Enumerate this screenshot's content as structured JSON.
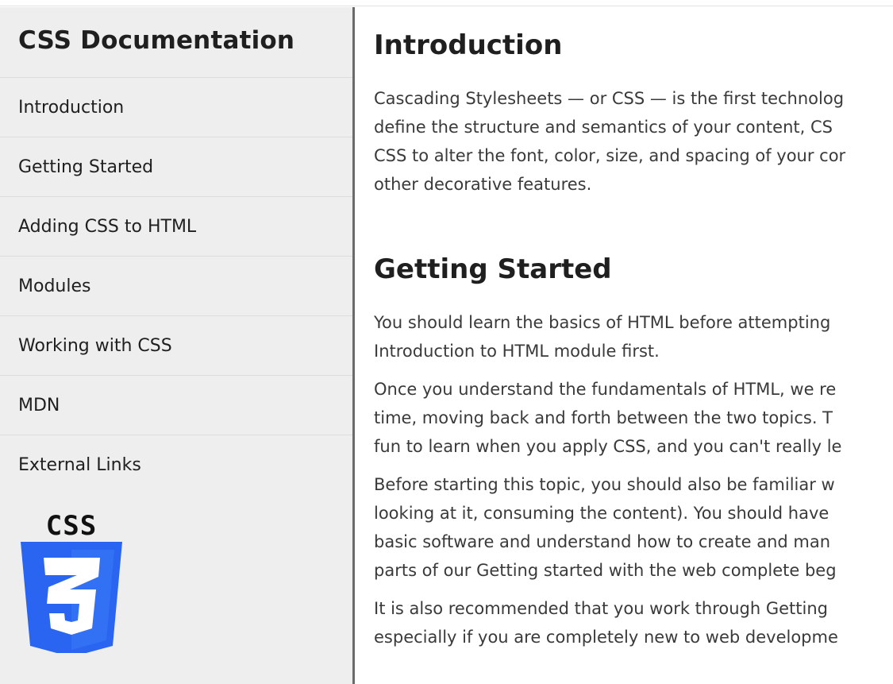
{
  "sidebar": {
    "title": "CSS Documentation",
    "items": [
      {
        "label": "Introduction"
      },
      {
        "label": "Getting Started"
      },
      {
        "label": "Adding CSS to HTML"
      },
      {
        "label": "Modules"
      },
      {
        "label": "Working with CSS"
      },
      {
        "label": "MDN"
      },
      {
        "label": "External Links"
      }
    ],
    "logo_text": "CSS",
    "logo_color": "#2965f1"
  },
  "main": {
    "sections": [
      {
        "title": "Introduction",
        "paragraphs": [
          [
            "Cascading Stylesheets — or CSS — is the first technolog",
            "define the structure and semantics of your content, CS",
            "CSS to alter the font, color, size, and spacing of your cor",
            "other decorative features."
          ]
        ]
      },
      {
        "title": "Getting Started",
        "paragraphs": [
          [
            "You should learn the basics of HTML before attempting",
            "Introduction to HTML module first."
          ],
          [
            "Once you understand the fundamentals of HTML, we re",
            "time, moving back and forth between the two topics. T",
            "fun to learn when you apply CSS, and you can't really le"
          ],
          [
            "Before starting this topic, you should also be familiar w",
            "looking at it, consuming the content). You should have",
            "basic software and understand how to create and man",
            "parts of our Getting started with the web complete beg"
          ],
          [
            "It is also recommended that you work through Getting",
            "especially if you are completely new to web developme"
          ]
        ]
      }
    ]
  }
}
